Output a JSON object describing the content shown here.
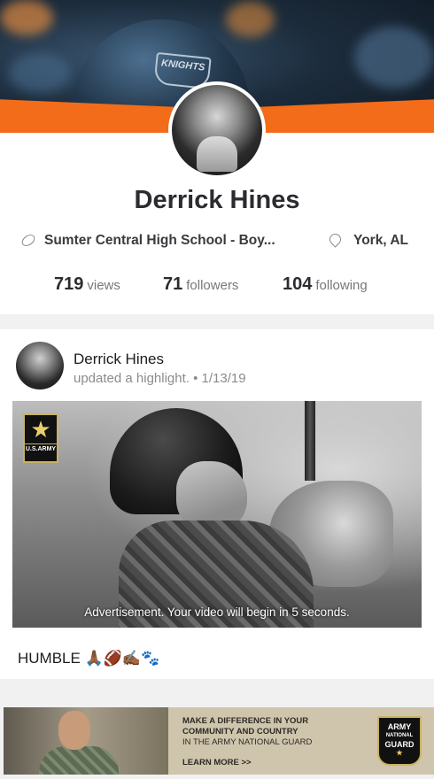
{
  "banner": {
    "helmet_text": "KNIGHTS"
  },
  "profile": {
    "name": "Derrick Hines",
    "school": "Sumter Central High School - Boy...",
    "location": "York, AL",
    "stats": {
      "views_count": "719",
      "views_label": "views",
      "followers_count": "71",
      "followers_label": "followers",
      "following_count": "104",
      "following_label": "following"
    }
  },
  "post": {
    "author": "Derrick Hines",
    "meta": "updated a highlight. • 1/13/19",
    "video": {
      "badge_label": "U.S.ARMY",
      "ad_notice": "Advertisement. Your video will begin in 5 seconds."
    },
    "caption": "HUMBLE 🙏🏾🏈✍🏾🐾"
  },
  "ad_banner": {
    "line1": "MAKE A DIFFERENCE IN YOUR",
    "line2": "COMMUNITY AND COUNTRY",
    "line3": "IN THE ARMY NATIONAL GUARD",
    "cta": "LEARN MORE >>",
    "logo_line1": "ARMY",
    "logo_line2": "NATIONAL",
    "logo_line3": "GUARD"
  },
  "colors": {
    "accent_orange": "#f26c1a",
    "text_dark": "#2b2b30",
    "text_muted": "#77777d"
  },
  "icons": {
    "school": "football-icon",
    "location": "map-pin-icon",
    "army_star": "star-icon"
  }
}
